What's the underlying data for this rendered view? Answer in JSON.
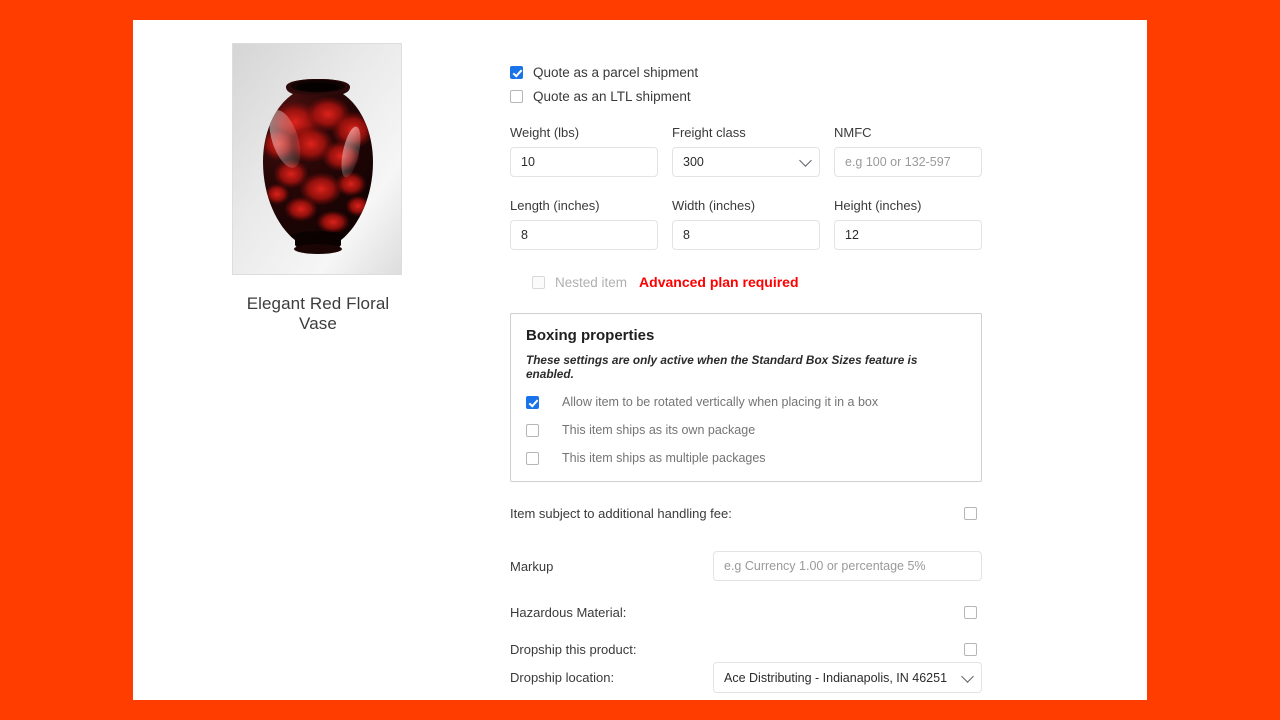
{
  "theme": {
    "background": "#ff3d00",
    "panel": "#ffffff",
    "accent_checkbox": "#1a73e8",
    "warning_text": "#ff0000"
  },
  "product": {
    "image_alt": "vase-product-image",
    "caption": "Elegant Red Floral Vase"
  },
  "shipping_mode": {
    "parcel": {
      "label": "Quote as a parcel shipment",
      "checked": true
    },
    "ltl": {
      "label": "Quote as an LTL shipment",
      "checked": false
    }
  },
  "dimensions": {
    "weight": {
      "label": "Weight (lbs)",
      "value": "10"
    },
    "freight_class": {
      "label": "Freight class",
      "value": "300"
    },
    "nmfc": {
      "label": "NMFC",
      "value": "",
      "placeholder": "e.g 100 or 132-597"
    },
    "length": {
      "label": "Length (inches)",
      "value": "8"
    },
    "width": {
      "label": "Width (inches)",
      "value": "8"
    },
    "height": {
      "label": "Height (inches)",
      "value": "12"
    }
  },
  "nested": {
    "label": "Nested item",
    "checked": false,
    "disabled": true,
    "note": "Advanced plan required"
  },
  "boxing": {
    "title": "Boxing properties",
    "note": "These settings are only active when the Standard Box Sizes feature is enabled.",
    "options": [
      {
        "label": "Allow item to be rotated vertically when placing it in a box",
        "checked": true
      },
      {
        "label": "This item ships as its own package",
        "checked": false
      },
      {
        "label": "This item ships as multiple packages",
        "checked": false
      }
    ]
  },
  "settings": {
    "handling_fee": {
      "label": "Item subject to additional handling fee:",
      "checked": false
    },
    "markup": {
      "label": "Markup",
      "value": "",
      "placeholder": "e.g Currency 1.00 or percentage 5%"
    },
    "hazardous": {
      "label": "Hazardous Material:",
      "checked": false
    },
    "dropship_product": {
      "label": "Dropship this product:",
      "checked": false
    },
    "dropship_location": {
      "label": "Dropship location:",
      "value": "Ace Distributing - Indianapolis, IN 46251"
    }
  }
}
